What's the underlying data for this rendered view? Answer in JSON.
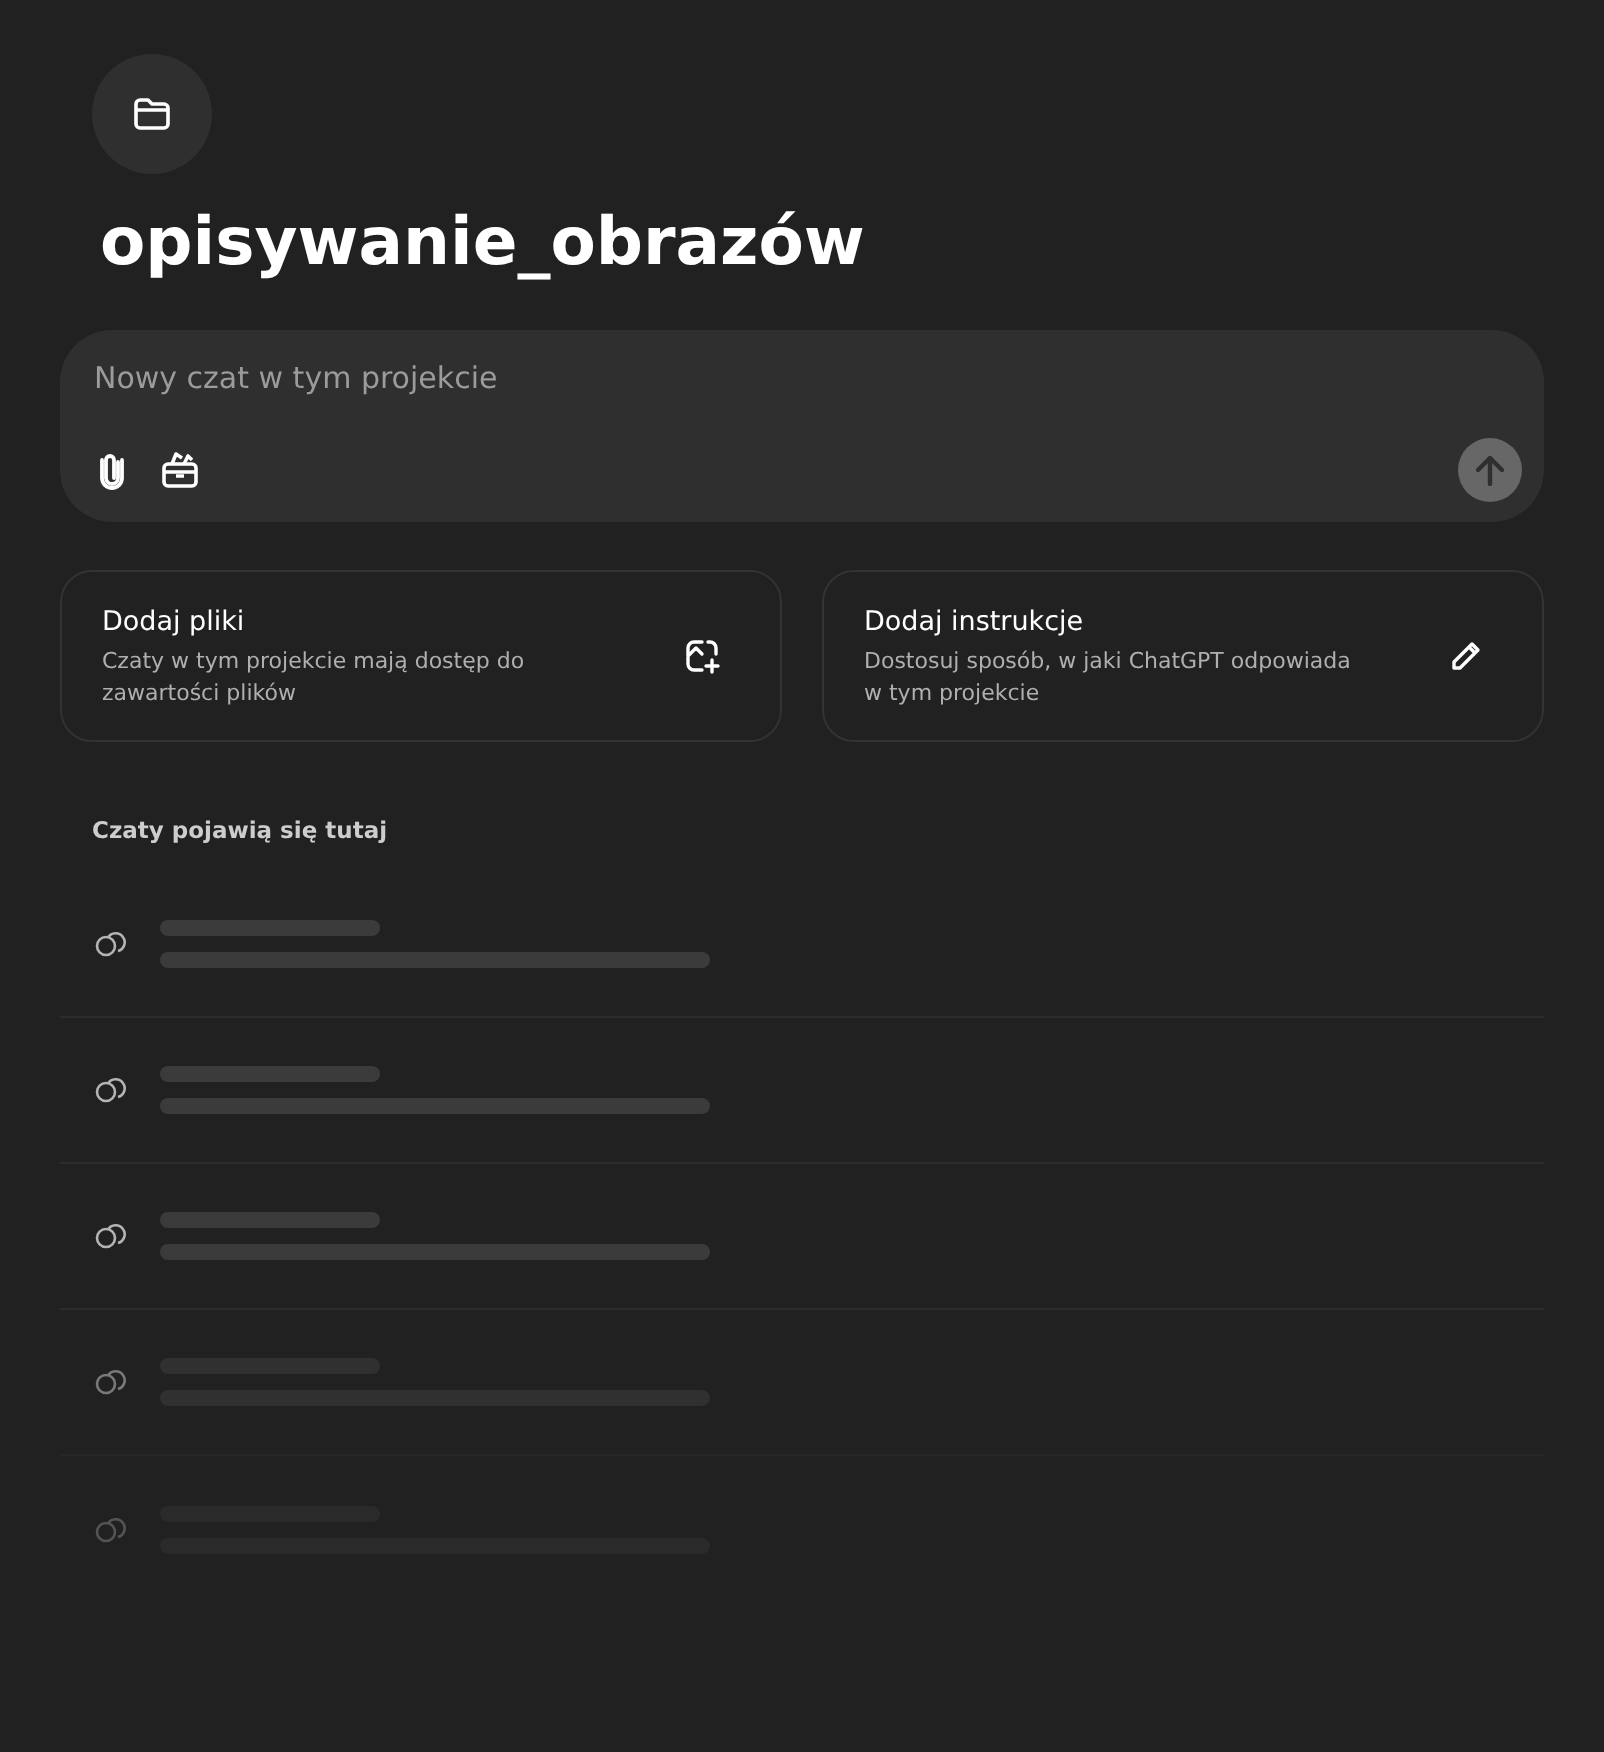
{
  "project": {
    "title": "opisywanie_obrazów"
  },
  "composer": {
    "placeholder": "Nowy czat w tym projekcie"
  },
  "cards": [
    {
      "kind": "files",
      "title": "Dodaj pliki",
      "description": "Czaty w tym projekcie mają dostęp do zawartości plików"
    },
    {
      "kind": "instructions",
      "title": "Dodaj instrukcje",
      "description": "Dostosuj sposób, w jaki ChatGPT odpowiada w tym projekcie"
    }
  ],
  "chats": {
    "heading": "Czaty pojawią się tutaj",
    "rows": [
      {
        "kind": "skeleton"
      },
      {
        "kind": "skeleton"
      },
      {
        "kind": "skeleton"
      },
      {
        "kind": "skeleton-faded"
      },
      {
        "kind": "skeleton-faint"
      }
    ]
  }
}
